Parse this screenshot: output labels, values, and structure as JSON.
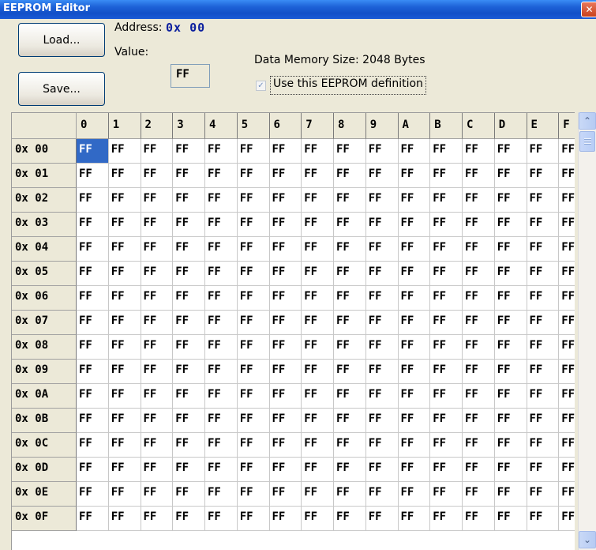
{
  "window": {
    "title": "EEPROM Editor",
    "close_glyph": "✕",
    "close_icon": "close-icon"
  },
  "toolbar": {
    "load_label": "Load...",
    "save_label": "Save..."
  },
  "address": {
    "label": "Address:",
    "value": "0x 00"
  },
  "value_field": {
    "label": "Value:",
    "value": "FF"
  },
  "info": {
    "data_memory_size": "Data Memory Size: 2048 Bytes"
  },
  "definition": {
    "checked": true,
    "check_glyph": "✓",
    "label": "Use this EEPROM definition"
  },
  "grid": {
    "columns": [
      "0",
      "1",
      "2",
      "3",
      "4",
      "5",
      "6",
      "7",
      "8",
      "9",
      "A",
      "B",
      "C",
      "D",
      "E",
      "F"
    ],
    "rows": [
      "0x 00",
      "0x 01",
      "0x 02",
      "0x 03",
      "0x 04",
      "0x 05",
      "0x 06",
      "0x 07",
      "0x 08",
      "0x 09",
      "0x 0A",
      "0x 0B",
      "0x 0C",
      "0x 0D",
      "0x 0E",
      "0x 0F"
    ],
    "cell_value": "FF",
    "selected": {
      "row": 0,
      "col": 0
    }
  },
  "scrollbar": {
    "up_glyph": "⌃",
    "down_glyph": "⌄"
  },
  "colors": {
    "title_bar": "#1e63d8",
    "selection": "#3169c6",
    "address_value": "#0b1f9e",
    "window_bg": "#ece9d8"
  }
}
